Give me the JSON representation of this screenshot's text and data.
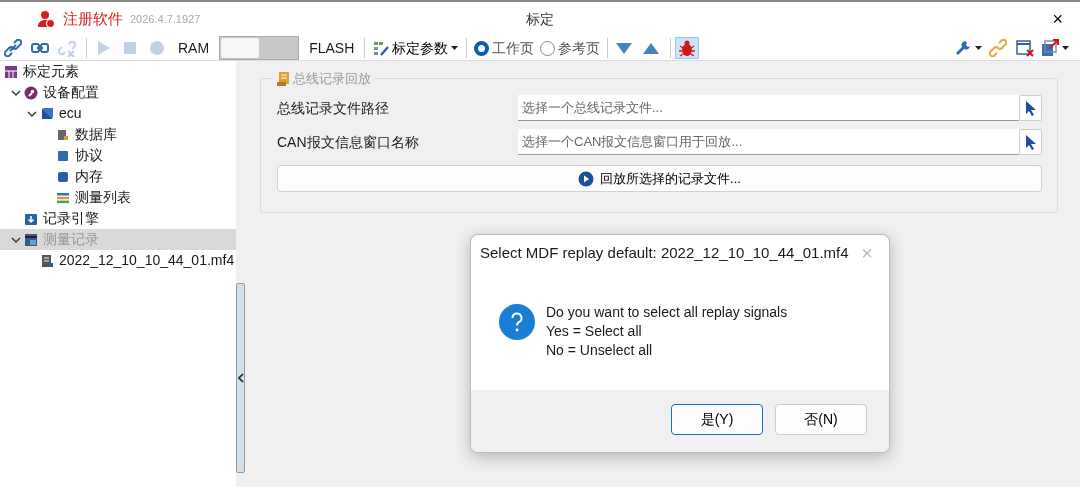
{
  "window": {
    "app_name": "注册软件",
    "version": "2026.4.7.1927",
    "title": "标定",
    "close": "×"
  },
  "toolbar": {
    "items": [
      {
        "kind": "icon",
        "disabled": false
      },
      {
        "kind": "icon",
        "disabled": false
      },
      {
        "kind": "icon",
        "disabled": true
      },
      {
        "kind": "separator"
      },
      {
        "kind": "icon",
        "disabled": true
      },
      {
        "kind": "icon",
        "disabled": true
      },
      {
        "kind": "icon",
        "disabled": true
      },
      {
        "kind": "label",
        "text": "RAM"
      },
      {
        "kind": "switch",
        "on": false
      },
      {
        "kind": "label",
        "text": "FLASH"
      },
      {
        "kind": "separator"
      },
      {
        "kind": "dropdown",
        "text": "标定参数"
      },
      {
        "kind": "separator"
      },
      {
        "kind": "radio",
        "text": "工作页",
        "selected": true
      },
      {
        "kind": "radio",
        "text": "参考页",
        "selected": false
      },
      {
        "kind": "separator"
      },
      {
        "kind": "icon",
        "disabled": false
      },
      {
        "kind": "icon",
        "disabled": false
      },
      {
        "kind": "separator"
      },
      {
        "kind": "toggle",
        "pressed": true
      }
    ],
    "right_items": [
      {
        "has_menu": true
      },
      {
        "has_menu": false
      },
      {
        "has_menu": false
      },
      {
        "has_menu": true
      }
    ]
  },
  "tree": [
    {
      "label": "标定元素",
      "selected": false,
      "children": [
        {
          "label": "设备配置",
          "expanded": true,
          "selected": false,
          "children": [
            {
              "label": "ecu",
              "expanded": true,
              "selected": false,
              "children": [
                {
                  "label": "数据库",
                  "selected": false
                },
                {
                  "label": "协议",
                  "selected": false
                },
                {
                  "label": "内存",
                  "selected": false
                },
                {
                  "label": "测量列表",
                  "selected": false
                }
              ]
            }
          ]
        },
        {
          "label": "记录引擎",
          "selected": false
        },
        {
          "label": "测量记录",
          "expanded": true,
          "selected": true,
          "children": [
            {
              "label": "2022_12_10_10_44_01.mf4",
              "selected": false
            }
          ]
        }
      ]
    }
  ],
  "group": {
    "title": "总线记录回放",
    "fields": [
      {
        "label": "总线记录文件路径",
        "placeholder": "选择一个总线记录文件..."
      },
      {
        "label": "CAN报文信息窗口名称",
        "placeholder": "选择一个CAN报文信息窗口用于回放..."
      }
    ],
    "button": "回放所选择的记录文件..."
  },
  "dialog": {
    "title": "Select MDF replay default: 2022_12_10_10_44_01.mf4",
    "close": "×",
    "lines": [
      "Do you want to select all replay signals",
      "Yes = Select all",
      "No = Unselect all"
    ],
    "buttons": [
      {
        "label": "是(Y)",
        "default": true
      },
      {
        "label": "否(N)",
        "default": false
      }
    ]
  }
}
